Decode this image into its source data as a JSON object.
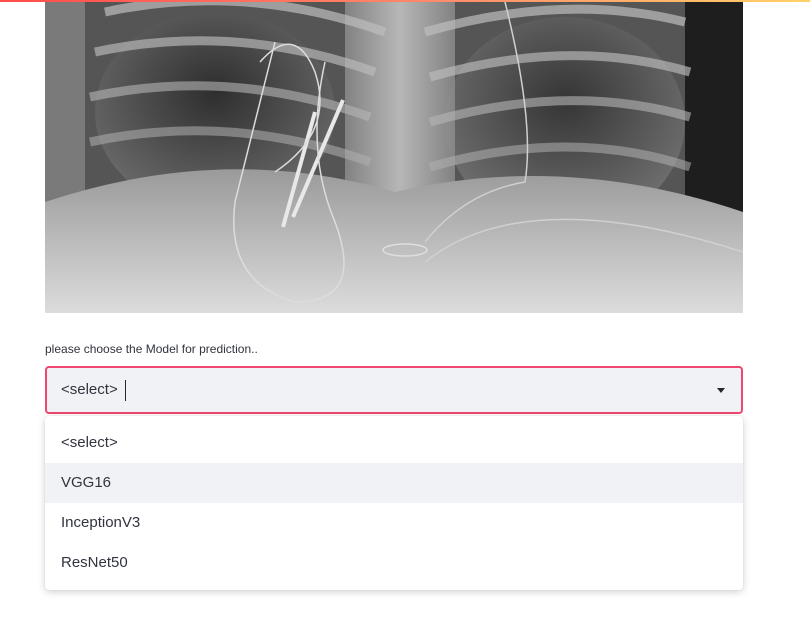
{
  "model_select": {
    "label": "please choose the Model for prediction..",
    "current_value": "<select>",
    "options": [
      "<select>",
      "VGG16",
      "InceptionV3",
      "ResNet50"
    ],
    "hovered_option": "VGG16"
  },
  "icons": {
    "dropdown": "chevron-down-icon"
  },
  "colors": {
    "focus_border": "#f0466f",
    "input_background": "#f0f2f6",
    "option_hover": "#f0f2f6"
  }
}
